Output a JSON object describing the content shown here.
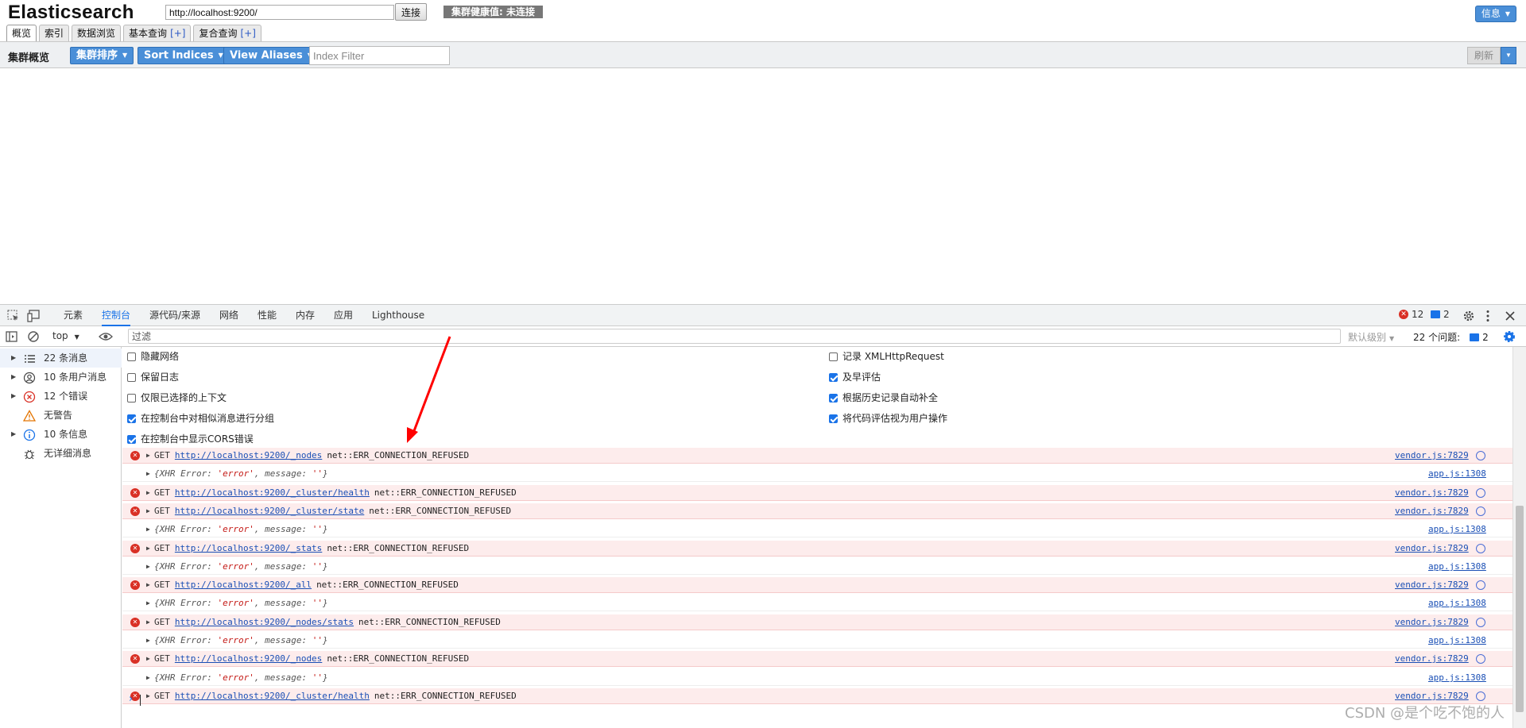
{
  "app": {
    "title": "Elasticsearch"
  },
  "header": {
    "url_value": "http://localhost:9200/",
    "connect_label": "连接",
    "health_label": "集群健康值: 未连接",
    "info_label": "信息",
    "tabs": [
      {
        "label": "概览",
        "plus": ""
      },
      {
        "label": "索引",
        "plus": ""
      },
      {
        "label": "数据浏览",
        "plus": ""
      },
      {
        "label": "基本查询",
        "plus": "[+]"
      },
      {
        "label": "复合查询",
        "plus": "[+]"
      }
    ]
  },
  "toolbar": {
    "overview_label": "集群概览",
    "sort_cluster": "集群排序",
    "sort_indices": "Sort Indices",
    "view_aliases": "View Aliases",
    "index_filter_placeholder": "Index Filter",
    "refresh_label": "刷新"
  },
  "devtools": {
    "tabs": [
      "元素",
      "控制台",
      "源代码/来源",
      "网络",
      "性能",
      "内存",
      "应用",
      "Lighthouse"
    ],
    "active_tab": "控制台",
    "error_count": "12",
    "message_count": "2",
    "context": "top",
    "filter_placeholder": "过滤",
    "level_label": "默认级别",
    "issues_label": "22 个问题:",
    "issues_count": "2",
    "sidebar": [
      {
        "label": "22 条消息",
        "icon": "list-icon",
        "expandable": true
      },
      {
        "label": "10 条用户消息",
        "icon": "user-icon",
        "expandable": true
      },
      {
        "label": "12 个错误",
        "icon": "error-icon",
        "expandable": true
      },
      {
        "label": "无警告",
        "icon": "warning-icon",
        "expandable": false
      },
      {
        "label": "10 条信息",
        "icon": "info-icon",
        "expandable": true
      },
      {
        "label": "无详细消息",
        "icon": "bug-icon",
        "expandable": false
      }
    ],
    "settings_left": [
      {
        "label": "隐藏网络",
        "checked": false
      },
      {
        "label": "保留日志",
        "checked": false
      },
      {
        "label": "仅限已选择的上下文",
        "checked": false
      },
      {
        "label": "在控制台中对相似消息进行分组",
        "checked": true
      },
      {
        "label": "在控制台中显示CORS错误",
        "checked": true
      }
    ],
    "settings_right": [
      {
        "label": "记录 XMLHttpRequest",
        "checked": false
      },
      {
        "label": "及早评估",
        "checked": true
      },
      {
        "label": "根据历史记录自动补全",
        "checked": true
      },
      {
        "label": "将代码评估视为用户操作",
        "checked": true
      }
    ],
    "logs": [
      {
        "type": "error",
        "method": "GET",
        "url": "http://localhost:9200/_nodes",
        "error": "net::ERR_CONNECTION_REFUSED",
        "source": "vendor.js:7829"
      },
      {
        "type": "obj",
        "text": "{XHR Error: ",
        "str": "'error'",
        "text2": ", message: ",
        "str2": "''",
        "end": "}",
        "source": "app.js:1308"
      },
      {
        "type": "error",
        "method": "GET",
        "url": "http://localhost:9200/_cluster/health",
        "error": "net::ERR_CONNECTION_REFUSED",
        "source": "vendor.js:7829"
      },
      {
        "type": "error",
        "method": "GET",
        "url": "http://localhost:9200/_cluster/state",
        "error": "net::ERR_CONNECTION_REFUSED",
        "source": "vendor.js:7829"
      },
      {
        "type": "obj",
        "text": "{XHR Error: ",
        "str": "'error'",
        "text2": ", message: ",
        "str2": "''",
        "end": "}",
        "source": "app.js:1308"
      },
      {
        "type": "error",
        "method": "GET",
        "url": "http://localhost:9200/_stats",
        "error": "net::ERR_CONNECTION_REFUSED",
        "source": "vendor.js:7829"
      },
      {
        "type": "obj",
        "text": "{XHR Error: ",
        "str": "'error'",
        "text2": ", message: ",
        "str2": "''",
        "end": "}",
        "source": "app.js:1308"
      },
      {
        "type": "error",
        "method": "GET",
        "url": "http://localhost:9200/_all",
        "error": "net::ERR_CONNECTION_REFUSED",
        "source": "vendor.js:7829"
      },
      {
        "type": "obj",
        "text": "{XHR Error: ",
        "str": "'error'",
        "text2": ", message: ",
        "str2": "''",
        "end": "}",
        "source": "app.js:1308"
      },
      {
        "type": "error",
        "method": "GET",
        "url": "http://localhost:9200/_nodes/stats",
        "error": "net::ERR_CONNECTION_REFUSED",
        "source": "vendor.js:7829"
      },
      {
        "type": "obj",
        "text": "{XHR Error: ",
        "str": "'error'",
        "text2": ", message: ",
        "str2": "''",
        "end": "}",
        "source": "app.js:1308"
      },
      {
        "type": "error",
        "method": "GET",
        "url": "http://localhost:9200/_nodes",
        "error": "net::ERR_CONNECTION_REFUSED",
        "source": "vendor.js:7829"
      },
      {
        "type": "obj",
        "text": "{XHR Error: ",
        "str": "'error'",
        "text2": ", message: ",
        "str2": "''",
        "end": "}",
        "source": "app.js:1308"
      },
      {
        "type": "error",
        "method": "GET",
        "url": "http://localhost:9200/_cluster/health",
        "error": "net::ERR_CONNECTION_REFUSED",
        "source": "vendor.js:7829"
      }
    ]
  },
  "watermark": "CSDN @是个吃不饱的人",
  "colors": {
    "accent": "#4a8fd8",
    "error": "#d93025",
    "devtools_blue": "#1a73e8",
    "annotation_arrow": "#ff0000"
  }
}
